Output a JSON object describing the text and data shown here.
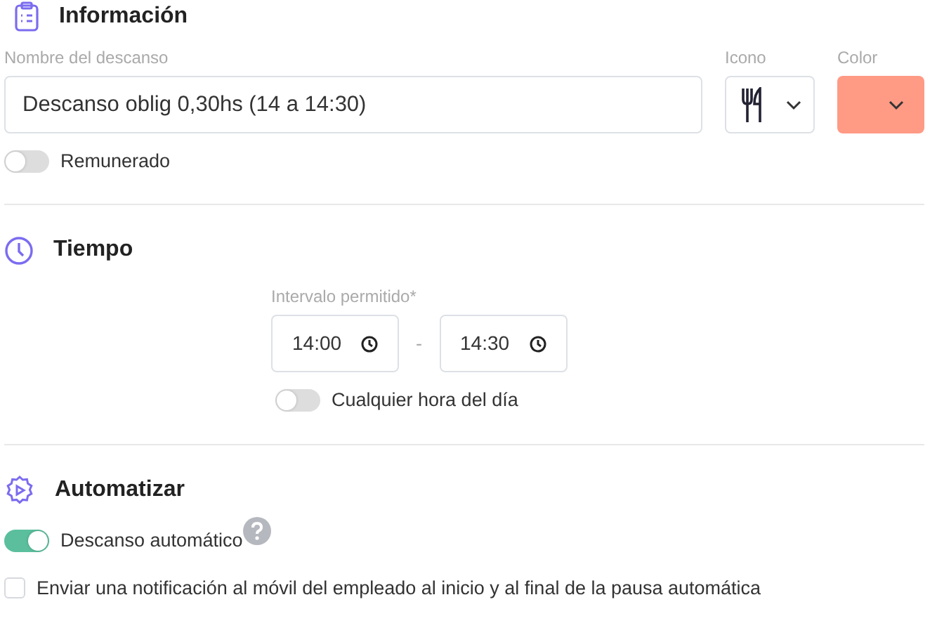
{
  "informacion": {
    "title": "Información",
    "name_field": {
      "label": "Nombre del descanso",
      "value": "Descanso oblig 0,30hs (14 a 14:30)"
    },
    "icon_field": {
      "label": "Icono"
    },
    "color_field": {
      "label": "Color",
      "color": "#ff9a85"
    },
    "paid_toggle": {
      "label": "Remunerado",
      "on": false
    }
  },
  "tiempo": {
    "title": "Tiempo",
    "interval": {
      "label": "Intervalo permitido*",
      "start": "14:00",
      "separator": "-",
      "end": "14:30"
    },
    "any_time_toggle": {
      "label": "Cualquier hora del día",
      "on": false
    }
  },
  "automatizar": {
    "title": "Automatizar",
    "auto_toggle": {
      "label": "Descanso automático",
      "on": true
    },
    "notify_checkbox": {
      "label": "Enviar una notificación al móvil del empleado al inicio y al final de la pausa automática",
      "checked": false
    }
  }
}
